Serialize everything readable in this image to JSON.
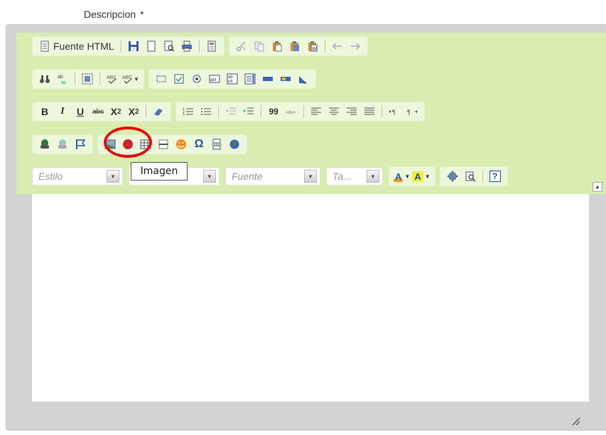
{
  "field": {
    "label": "Descripcion",
    "required_mark": "*"
  },
  "toolbar": {
    "source_label": "Fuente HTML",
    "bold": "B",
    "italic": "I",
    "underline": "U",
    "strike": "abc",
    "subscript": "X",
    "subscript_idx": "2",
    "superscript": "X",
    "superscript_idx": "2",
    "quote": "99",
    "omega": "Ω",
    "help": "?",
    "font_color_letter": "A",
    "bg_color_letter": "A"
  },
  "combos": {
    "style": "Estilo",
    "format": "",
    "font": "Fuente",
    "size": "Ta..."
  },
  "tooltip": {
    "text": "Imagen"
  },
  "colors": {
    "toolbar_bg": "#d9edb0",
    "group_bg": "#edf7dc",
    "highlight_circle": "#e01010"
  }
}
